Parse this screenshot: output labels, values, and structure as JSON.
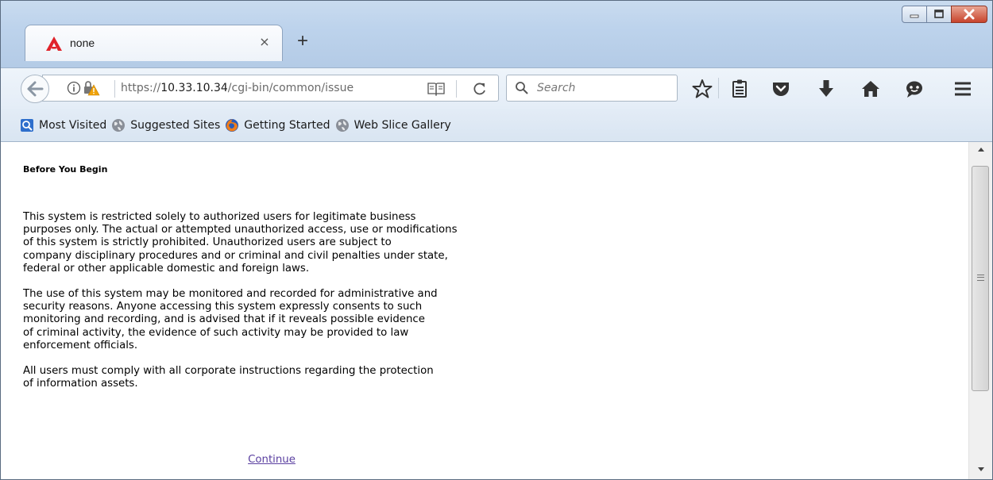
{
  "browser": {
    "tab": {
      "title": "none",
      "close_glyph": "×",
      "favicon": "red-a-logo-icon"
    },
    "new_tab_glyph": "+",
    "window_controls": [
      "minimize-icon",
      "maximize-icon",
      "close-icon"
    ],
    "url": {
      "scheme": "https://",
      "host": "10.33.10.34",
      "path": "/cgi-bin/common/issue"
    },
    "search": {
      "placeholder": "Search"
    },
    "toolbar_icons": [
      "star-icon",
      "reading-list-icon",
      "pocket-icon",
      "download-icon",
      "home-icon",
      "chat-icon",
      "menu-icon"
    ],
    "bookmarks": [
      {
        "label": "Most Visited",
        "icon": "most-visited-icon"
      },
      {
        "label": "Suggested Sites",
        "icon": "globe-icon"
      },
      {
        "label": "Getting Started",
        "icon": "firefox-icon"
      },
      {
        "label": "Web Slice Gallery",
        "icon": "globe-icon"
      }
    ]
  },
  "page": {
    "heading": "Before You Begin",
    "paragraphs": [
      "This system is restricted solely to authorized users for legitimate business\npurposes only. The actual or attempted unauthorized access, use or modifications\nof this system is strictly prohibited. Unauthorized users are subject to\ncompany disciplinary procedures and or criminal and civil penalties under state,\nfederal or other applicable domestic and foreign laws.",
      "The use of this system may be monitored and recorded for administrative and\nsecurity reasons. Anyone accessing this system expressly consents to such\nmonitoring and recording, and is advised that if it reveals possible evidence\nof criminal activity, the evidence of such activity may be provided to law\nenforcement officials.",
      "All users must comply with all corporate instructions regarding the protection\nof information assets."
    ],
    "continue_label": "Continue"
  },
  "colors": {
    "link": "#5a3fa0",
    "accent_red": "#e0232b",
    "warning": "#f0a30a"
  }
}
